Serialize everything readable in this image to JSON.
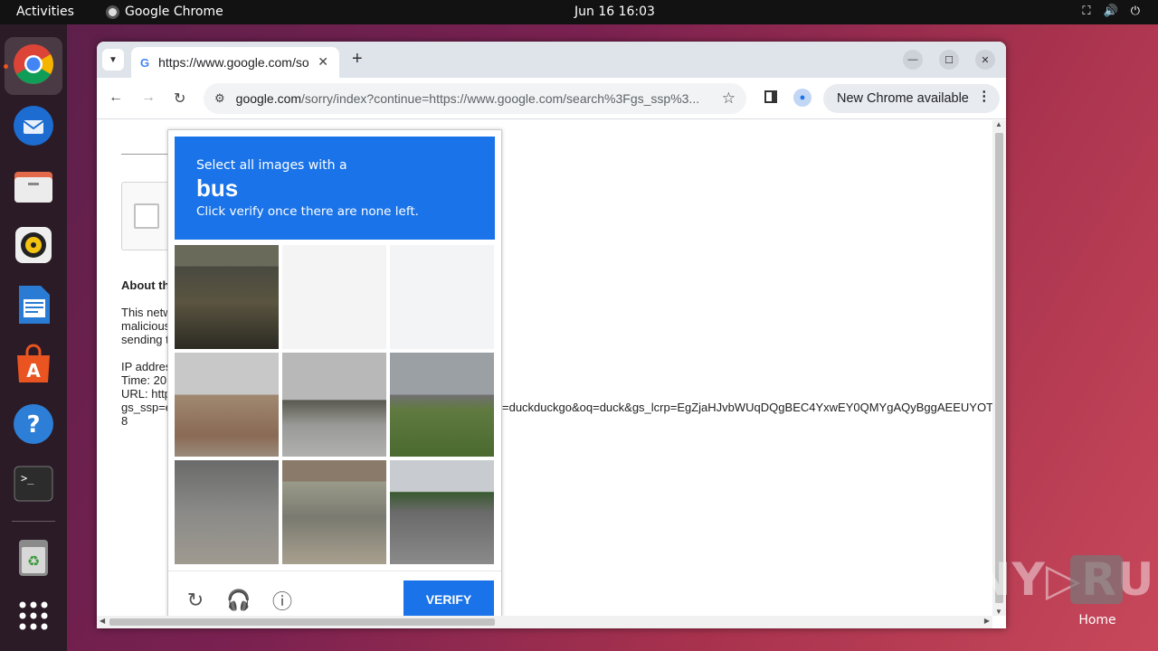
{
  "topbar": {
    "activities": "Activities",
    "app_name": "Google Chrome",
    "datetime": "Jun 16  16:03"
  },
  "dock": {
    "items": [
      "chrome-icon",
      "thunderbird-icon",
      "files-icon",
      "rhythmbox-icon",
      "writer-icon",
      "app-center-icon",
      "help-icon",
      "terminal-icon",
      "trash-icon",
      "app-grid-icon"
    ]
  },
  "browser": {
    "tab_title": "https://www.google.com/sorry/index",
    "tab_favicon": "G",
    "url_domain": "google.com",
    "url_rest": "/sorry/index?continue=https://www.google.com/search%3Fgs_ssp%3...",
    "new_chrome_label": "New Chrome available"
  },
  "page": {
    "about_heading": "About th",
    "para_lines": [
      "This netw",
      "malicious",
      "sending t"
    ],
    "ip_lines": [
      "IP addres",
      "Time: 20",
      "URL: http",
      "gs_ssp=e",
      "8"
    ],
    "url_tail": "=duckduckgo&oq=duck&gs_lcrp=EgZjaHJvbWUqDQgBEC4YxwEY0QMYgAQyBggAEEUYOT"
  },
  "captcha": {
    "line1": "Select all images with a",
    "target": "bus",
    "line3": "Click verify once there are none left.",
    "verify_label": "VERIFY",
    "accent": "#1a73e8"
  },
  "desktop": {
    "home_label": "Home",
    "watermark": "ANY▷RUN"
  }
}
